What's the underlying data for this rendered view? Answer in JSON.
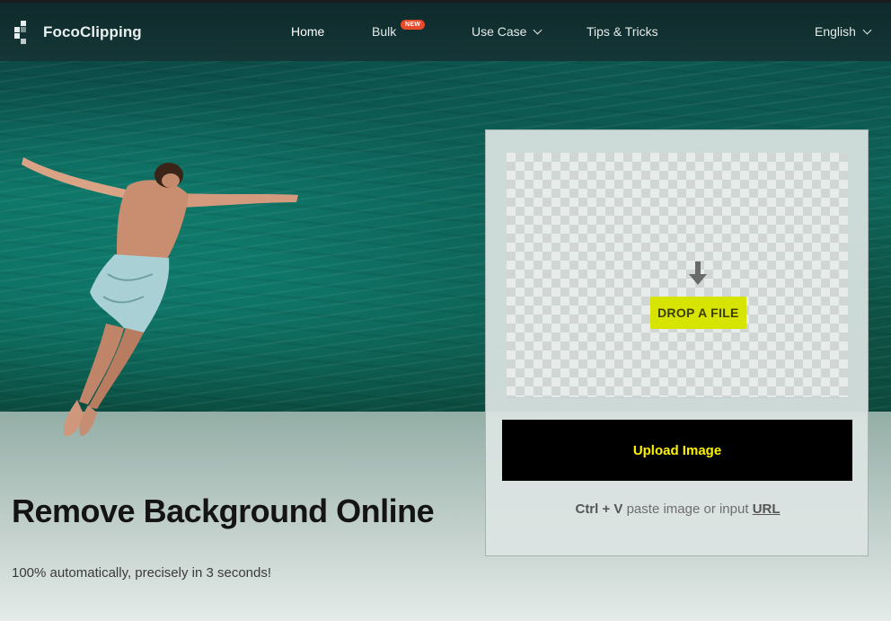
{
  "nav": {
    "brand": "FocoClipping",
    "items": [
      {
        "label": "Home"
      },
      {
        "label": "Bulk",
        "badge": "NEW"
      },
      {
        "label": "Use Case"
      },
      {
        "label": "Tips & Tricks"
      }
    ],
    "language": "English"
  },
  "hero": {
    "title": "Remove Background Online",
    "subtitle": "100% automatically, precisely in 3 seconds!"
  },
  "upload": {
    "drop_label": "DROP A FILE",
    "button_label": "Upload Image",
    "shortcut": "Ctrl + V",
    "paste_text": " paste image or input ",
    "url_label": "URL"
  },
  "colors": {
    "accent_yellow": "#fff200",
    "drop_highlight": "#d6e400",
    "badge_red": "#e84a2a",
    "nav_bg": "#0f2a2c"
  }
}
